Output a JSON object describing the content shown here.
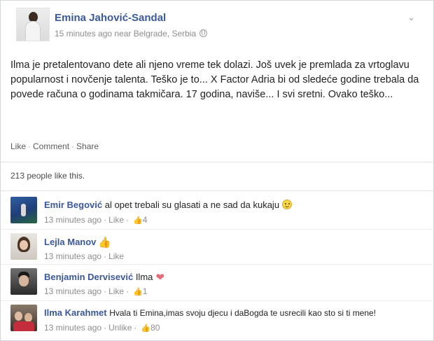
{
  "post": {
    "author": "Emina Jahović-Sandal",
    "timestamp": "15 minutes ago near Belgrade, Serbia",
    "body": "Ilma je pretalentovano dete ali njeno vreme tek dolazi. Još uvek je premlada za vrtoglavu popularnost i novčenje talenta. Teško je to... X Factor Adria bi od sledeće godine trebala da povede računa o godinama takmičara. 17 godina, naviše... I svi sretni. Ovako teško...",
    "privacy_icon": "globe-icon",
    "menu_icon": "chevron-down-icon"
  },
  "actions": {
    "like": "Like",
    "comment": "Comment",
    "share": "Share",
    "separator": "·"
  },
  "likes_summary": "213 people like this.",
  "comments": [
    {
      "name": "Emir Begović",
      "text": "al opet trebali su glasati a ne sad da kukaju",
      "emoticon": "smile-icon",
      "time": "13 minutes ago",
      "action": "Like",
      "like_count": "4"
    },
    {
      "name": "Lejla Manov",
      "text": "",
      "emoticon": "thumbs-up-emoticon",
      "time": "13 minutes ago",
      "action": "Like",
      "like_count": ""
    },
    {
      "name": "Benjamin Dervisević",
      "text": "Ilma",
      "emoticon": "heart-icon",
      "time": "13 minutes ago",
      "action": "Like",
      "like_count": "1"
    },
    {
      "name": "Ilma Karahmet",
      "text": "Hvala ti Emina,imas svoju djecu i daBogda te usrecili kao sto si ti mene!",
      "emoticon": "",
      "time": "13 minutes ago",
      "action": "Unlike",
      "like_count": "80"
    }
  ],
  "colors": {
    "name_link": "#3b5998",
    "meta_text": "#8d8d8d",
    "divider": "#e1e2e3"
  }
}
